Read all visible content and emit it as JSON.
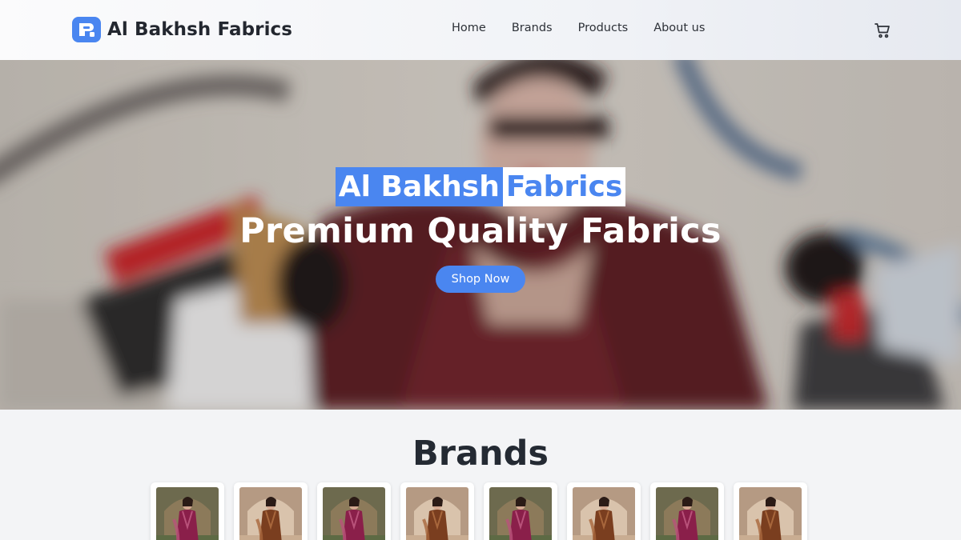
{
  "header": {
    "brand_name": "Al Bakhsh Fabrics",
    "nav": [
      "Home",
      "Brands",
      "Products",
      "About us"
    ]
  },
  "hero": {
    "title_part1": "Al Bakhsh",
    "title_part2": "Fabrics",
    "subtitle": "Premium Quality Fabrics",
    "cta_label": "Shop Now"
  },
  "brands": {
    "heading": "Brands",
    "cards": [
      {
        "variant": "magenta"
      },
      {
        "variant": "rust"
      },
      {
        "variant": "magenta"
      },
      {
        "variant": "rust"
      },
      {
        "variant": "magenta"
      },
      {
        "variant": "rust"
      },
      {
        "variant": "magenta"
      },
      {
        "variant": "rust"
      }
    ]
  },
  "colors": {
    "accent": "#4a86f0",
    "heading": "#242a33"
  },
  "icons": {
    "logo": "logo-icon",
    "cart": "cart-icon"
  }
}
